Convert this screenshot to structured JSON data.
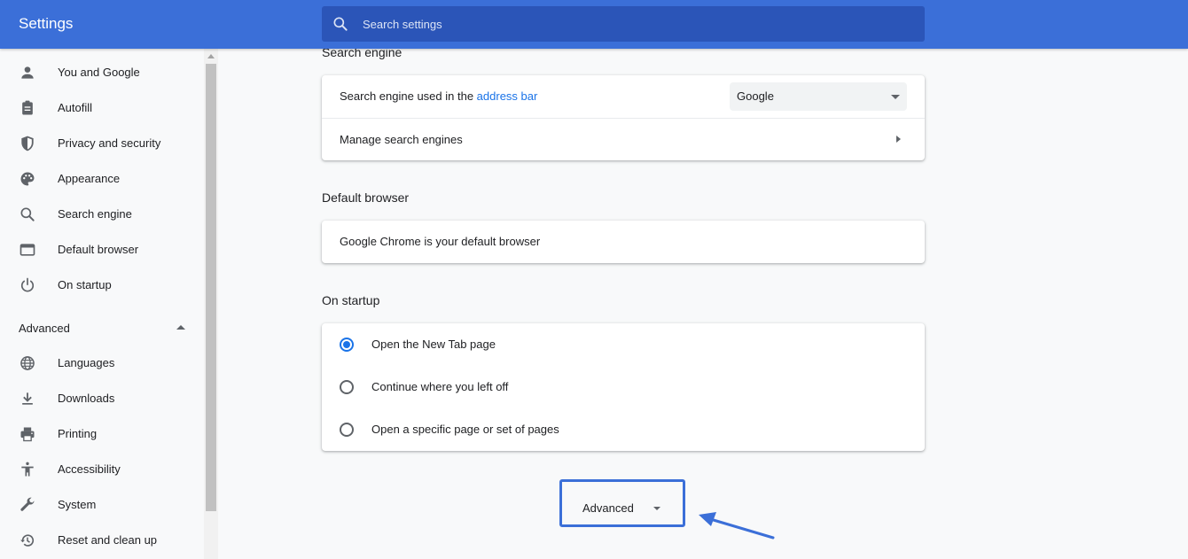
{
  "header": {
    "title": "Settings",
    "search_placeholder": "Search settings",
    "search_icon": "search-icon"
  },
  "sidebar": {
    "items": [
      {
        "label": "You and Google",
        "icon": "person-icon"
      },
      {
        "label": "Autofill",
        "icon": "clipboard-icon"
      },
      {
        "label": "Privacy and security",
        "icon": "shield-icon"
      },
      {
        "label": "Appearance",
        "icon": "palette-icon"
      },
      {
        "label": "Search engine",
        "icon": "search-icon"
      },
      {
        "label": "Default browser",
        "icon": "browser-window-icon"
      },
      {
        "label": "On startup",
        "icon": "power-icon"
      }
    ],
    "advanced": {
      "label": "Advanced",
      "expanded": true,
      "items": [
        {
          "label": "Languages",
          "icon": "globe-icon"
        },
        {
          "label": "Downloads",
          "icon": "download-icon"
        },
        {
          "label": "Printing",
          "icon": "printer-icon"
        },
        {
          "label": "Accessibility",
          "icon": "accessibility-icon"
        },
        {
          "label": "System",
          "icon": "wrench-icon"
        },
        {
          "label": "Reset and clean up",
          "icon": "history-icon"
        }
      ]
    }
  },
  "main": {
    "search_engine": {
      "title": "Search engine",
      "engine_label_prefix": "Search engine used in the ",
      "engine_label_link": "address bar",
      "selected_engine": "Google",
      "manage_label": "Manage search engines"
    },
    "default_browser": {
      "title": "Default browser",
      "status": "Google Chrome is your default browser"
    },
    "on_startup": {
      "title": "On startup",
      "options": [
        {
          "label": "Open the New Tab page",
          "checked": true
        },
        {
          "label": "Continue where you left off",
          "checked": false
        },
        {
          "label": "Open a specific page or set of pages",
          "checked": false
        }
      ]
    },
    "advanced_button": {
      "label": "Advanced"
    }
  },
  "colors": {
    "header_blue": "#3b6fd8",
    "search_box": "#2b55b8",
    "link_blue": "#1a73e8",
    "annotation_blue": "#3b6fd8"
  }
}
